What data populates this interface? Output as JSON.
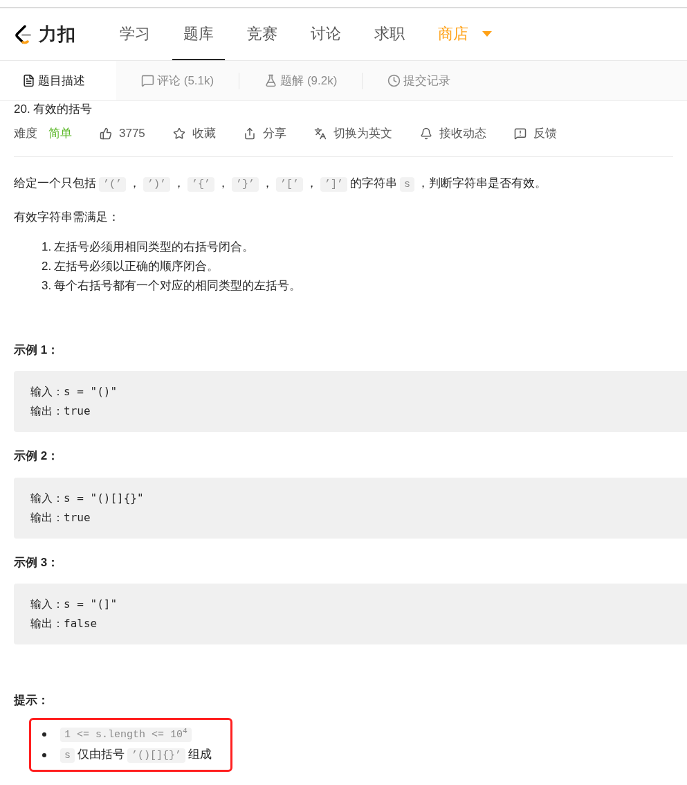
{
  "nav": {
    "logo_text": "力扣",
    "items": [
      {
        "label": "学习",
        "kind": "link",
        "selected": false
      },
      {
        "label": "题库",
        "kind": "link",
        "selected": true
      },
      {
        "label": "竞赛",
        "kind": "link",
        "selected": false
      },
      {
        "label": "讨论",
        "kind": "link",
        "selected": false
      },
      {
        "label": "求职",
        "kind": "link",
        "selected": false
      },
      {
        "label": "商店",
        "kind": "shop",
        "selected": false
      }
    ]
  },
  "tabs": [
    {
      "label": "题目描述",
      "kind": "description",
      "selected": true
    },
    {
      "label": "评论 (5.1k)",
      "kind": "comments",
      "selected": false
    },
    {
      "label": "题解 (9.2k)",
      "kind": "solutions",
      "selected": false
    },
    {
      "label": "提交记录",
      "kind": "submissions",
      "selected": false
    }
  ],
  "problem": {
    "title": "20. 有效的括号",
    "difficulty_label": "难度",
    "difficulty": "简单",
    "actions": [
      {
        "kind": "like",
        "label": "3775"
      },
      {
        "kind": "star",
        "label": "收藏"
      },
      {
        "kind": "share",
        "label": "分享"
      },
      {
        "kind": "translate",
        "label": "切换为英文"
      },
      {
        "kind": "bell",
        "label": "接收动态"
      },
      {
        "kind": "feedback",
        "label": "反馈"
      }
    ]
  },
  "description": [
    {
      "kind": "text",
      "text": "给定一个只包括"
    },
    {
      "kind": "code",
      "text": "’(’"
    },
    {
      "kind": "text",
      "text": "，"
    },
    {
      "kind": "code",
      "text": "’)’"
    },
    {
      "kind": "text",
      "text": "，"
    },
    {
      "kind": "code",
      "text": "’{’"
    },
    {
      "kind": "text",
      "text": "，"
    },
    {
      "kind": "code",
      "text": "’}’"
    },
    {
      "kind": "text",
      "text": "，"
    },
    {
      "kind": "code",
      "text": "’[’"
    },
    {
      "kind": "text",
      "text": "，"
    },
    {
      "kind": "code",
      "text": "’]’"
    },
    {
      "kind": "text",
      "text": "的字符串"
    },
    {
      "kind": "code",
      "text": "s"
    },
    {
      "kind": "text",
      "text": "，判断字符串是否有效。"
    }
  ],
  "requirement_intro": "有效字符串需满足：",
  "requirements": [
    {
      "number": "1.",
      "text": "左括号必须用相同类型的右括号闭合。"
    },
    {
      "number": "2.",
      "text": "左括号必须以正确的顺序闭合。"
    },
    {
      "number": "3.",
      "text": "每个右括号都有一个对应的相同类型的左括号。"
    }
  ],
  "examples": [
    {
      "title": "示例 1：",
      "lines": [
        "输入：s = \"()\"",
        "输出：true"
      ]
    },
    {
      "title": "示例 2：",
      "lines": [
        "输入：s = \"()[]{}\"",
        "输出：true"
      ]
    },
    {
      "title": "示例 3：",
      "lines": [
        "输入：s = \"(]\"",
        "输出：false"
      ]
    }
  ],
  "hints": {
    "title": "提示：",
    "highlighted": true,
    "items": [
      [
        {
          "kind": "code",
          "text": "1 <= s.length <= 10$^{4}$"
        }
      ],
      [
        {
          "kind": "code",
          "text": "s"
        },
        {
          "kind": "text",
          "text": "仅由括号"
        },
        {
          "kind": "code",
          "text": "’()[]{}’"
        },
        {
          "kind": "text",
          "text": "组成"
        }
      ]
    ]
  }
}
